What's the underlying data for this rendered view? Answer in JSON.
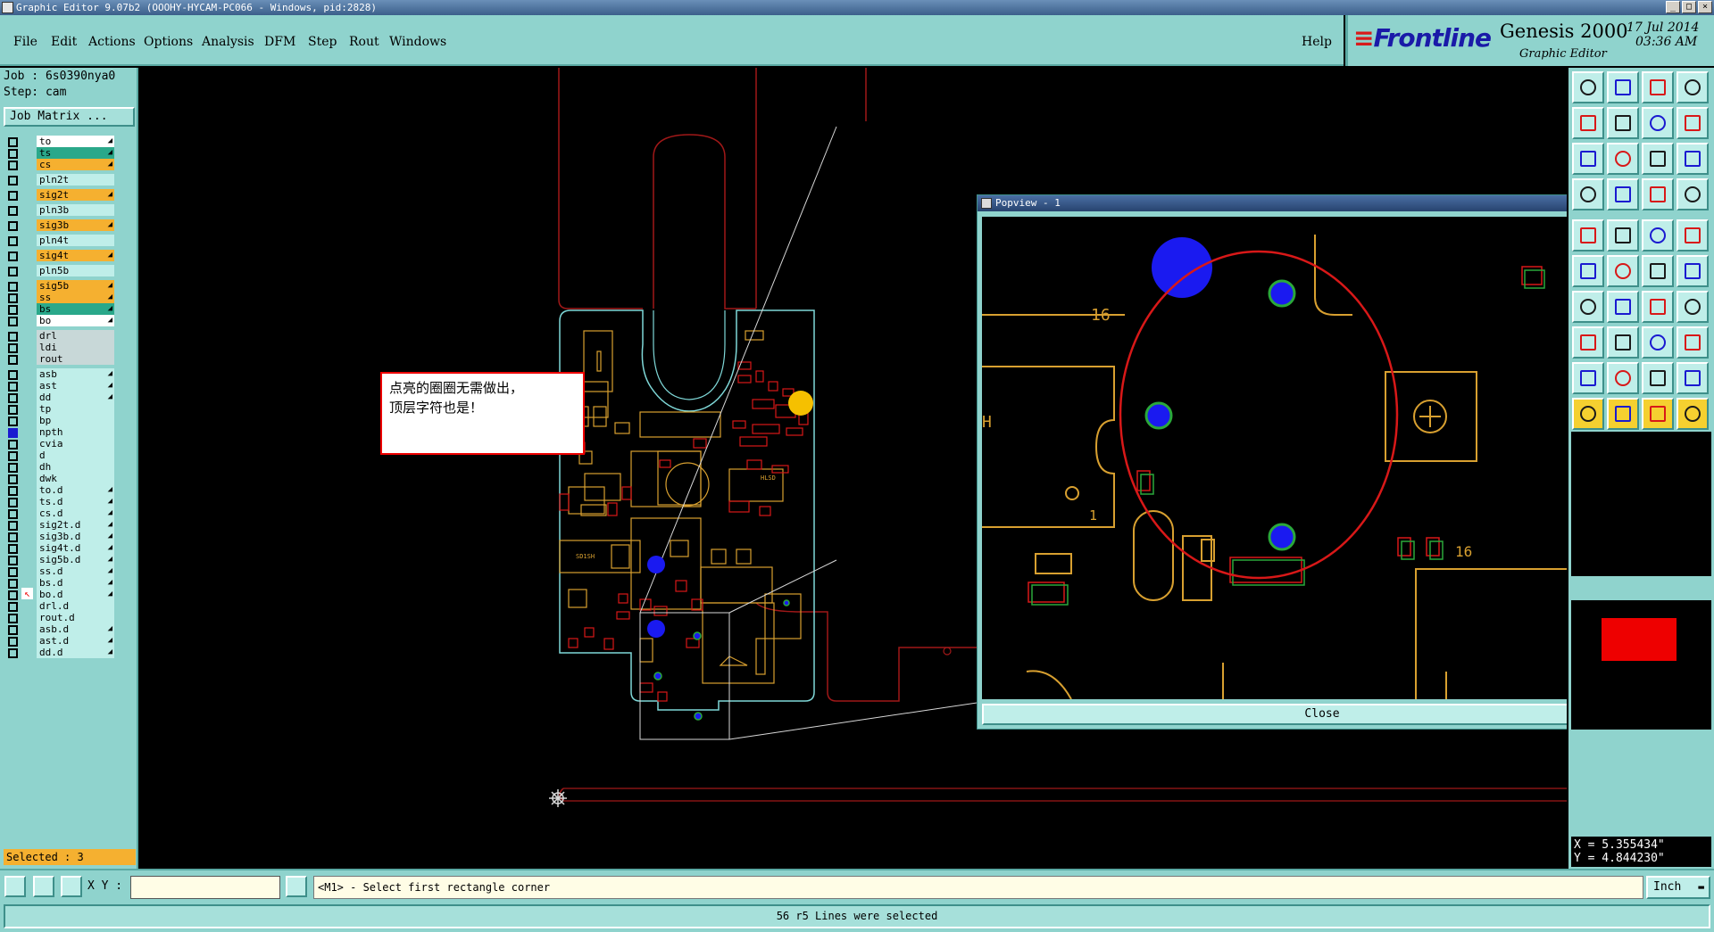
{
  "window": {
    "title": "Graphic Editor 9.07b2 (OOOHY-HYCAM-PC066 - Windows, pid:2828)"
  },
  "menu": [
    {
      "label": "File",
      "mnemonic": "F",
      "rest": "ile"
    },
    {
      "label": "Edit",
      "mnemonic": "E",
      "rest": "dit"
    },
    {
      "label": "Actions",
      "mnemonic": "A",
      "rest": "ctions"
    },
    {
      "label": "Options",
      "mnemonic": "O",
      "rest": "ptions"
    },
    {
      "label": "Analysis",
      "mnemonic": "A",
      "rest": "nalysis"
    },
    {
      "label": "DFM",
      "mnemonic": "D",
      "rest": "FM"
    },
    {
      "label": "Step",
      "mnemonic": "S",
      "rest": "tep"
    },
    {
      "label": "Rout",
      "mnemonic": "R",
      "rest": "out"
    },
    {
      "label": "Windows",
      "mnemonic": "W",
      "rest": "indows"
    }
  ],
  "help_label": "Help",
  "brand": {
    "logo": "Frontline",
    "product": "Genesis 2000",
    "subtitle": "Graphic Editor",
    "date": "17 Jul 2014",
    "time": "03:36 AM"
  },
  "job": {
    "job_line": "Job : 6s0390nya0",
    "step_line": "Step: cam",
    "matrix_button": "Job Matrix ..."
  },
  "layers": [
    {
      "name": "to",
      "style": "white",
      "flag": "on"
    },
    {
      "name": "ts",
      "style": "green",
      "flag": "on"
    },
    {
      "name": "cs",
      "style": "orange",
      "flag": "on"
    },
    {
      "name": "pln2t",
      "style": "cyan",
      "flag": ""
    },
    {
      "name": "sig2t",
      "style": "orange",
      "flag": "on"
    },
    {
      "name": "pln3b",
      "style": "cyan",
      "flag": ""
    },
    {
      "name": "sig3b",
      "style": "orange",
      "flag": "on"
    },
    {
      "name": "pln4t",
      "style": "cyan",
      "flag": ""
    },
    {
      "name": "sig4t",
      "style": "orange",
      "flag": "on"
    },
    {
      "name": "pln5b",
      "style": "cyan",
      "flag": ""
    },
    {
      "name": "sig5b",
      "style": "orange",
      "flag": "on"
    },
    {
      "name": "ss",
      "style": "orange",
      "flag": "on"
    },
    {
      "name": "bs",
      "style": "green",
      "flag": "on"
    },
    {
      "name": "bo",
      "style": "white",
      "flag": "on"
    },
    {
      "name": "drl",
      "style": "grey",
      "flag": ""
    },
    {
      "name": "ldi",
      "style": "grey",
      "flag": ""
    },
    {
      "name": "rout",
      "style": "grey",
      "flag": ""
    },
    {
      "name": "asb",
      "style": "cyan",
      "flag": "on"
    },
    {
      "name": "ast",
      "style": "cyan",
      "flag": "on"
    },
    {
      "name": "dd",
      "style": "cyan",
      "flag": "on"
    },
    {
      "name": "tp",
      "style": "cyan",
      "flag": ""
    },
    {
      "name": "bp",
      "style": "cyan",
      "flag": ""
    },
    {
      "name": "npth",
      "style": "cyan",
      "flag": "",
      "active": true
    },
    {
      "name": "cvia",
      "style": "cyan",
      "flag": ""
    },
    {
      "name": "d",
      "style": "cyan",
      "flag": ""
    },
    {
      "name": "dh",
      "style": "cyan",
      "flag": ""
    },
    {
      "name": "dwk",
      "style": "cyan",
      "flag": ""
    },
    {
      "name": "to.d",
      "style": "cyan",
      "flag": "on"
    },
    {
      "name": "ts.d",
      "style": "cyan",
      "flag": "on"
    },
    {
      "name": "cs.d",
      "style": "cyan",
      "flag": "on"
    },
    {
      "name": "sig2t.d",
      "style": "cyan",
      "flag": "on"
    },
    {
      "name": "sig3b.d",
      "style": "cyan",
      "flag": "on"
    },
    {
      "name": "sig4t.d",
      "style": "cyan",
      "flag": "on"
    },
    {
      "name": "sig5b.d",
      "style": "cyan",
      "flag": "on"
    },
    {
      "name": "ss.d",
      "style": "cyan",
      "flag": "on"
    },
    {
      "name": "bs.d",
      "style": "cyan",
      "flag": "on"
    },
    {
      "name": "bo.d",
      "style": "cyan",
      "flag": "on",
      "work": true
    },
    {
      "name": "drl.d",
      "style": "cyan",
      "flag": ""
    },
    {
      "name": "rout.d",
      "style": "cyan",
      "flag": ""
    },
    {
      "name": "asb.d",
      "style": "cyan",
      "flag": "on"
    },
    {
      "name": "ast.d",
      "style": "cyan",
      "flag": "on"
    },
    {
      "name": "dd.d",
      "style": "cyan",
      "flag": "on"
    }
  ],
  "selected_label": "Selected : 3",
  "annotation": "点亮的圈圈无需做出，\n顶层字符也是！",
  "popview": {
    "title": "Popview - 1",
    "close_label": "Close",
    "silk_16_top": "16",
    "silk_16_right": "16",
    "silk_1": "1",
    "silk_h": "H"
  },
  "board_text": {
    "ref_a": "SD1SH",
    "ref_b": "HLSD"
  },
  "coords": {
    "x": "X = 5.355434\"",
    "y": "Y = 4.844230\""
  },
  "cmd": {
    "xy_label": "X Y :",
    "xy_value": "",
    "prompt": "<M1> - Select first rectangle corner",
    "units": "Inch"
  },
  "status": "56 r5 Lines were selected",
  "colors": {
    "panel": "#8fd3cd",
    "outline_red": "#a01818",
    "outline_cyan": "#7fd8d8",
    "copper_orange": "#d8a030",
    "copper_red": "#d81818",
    "pad_blue": "#1a1af0",
    "pad_green": "#2aa83a"
  }
}
